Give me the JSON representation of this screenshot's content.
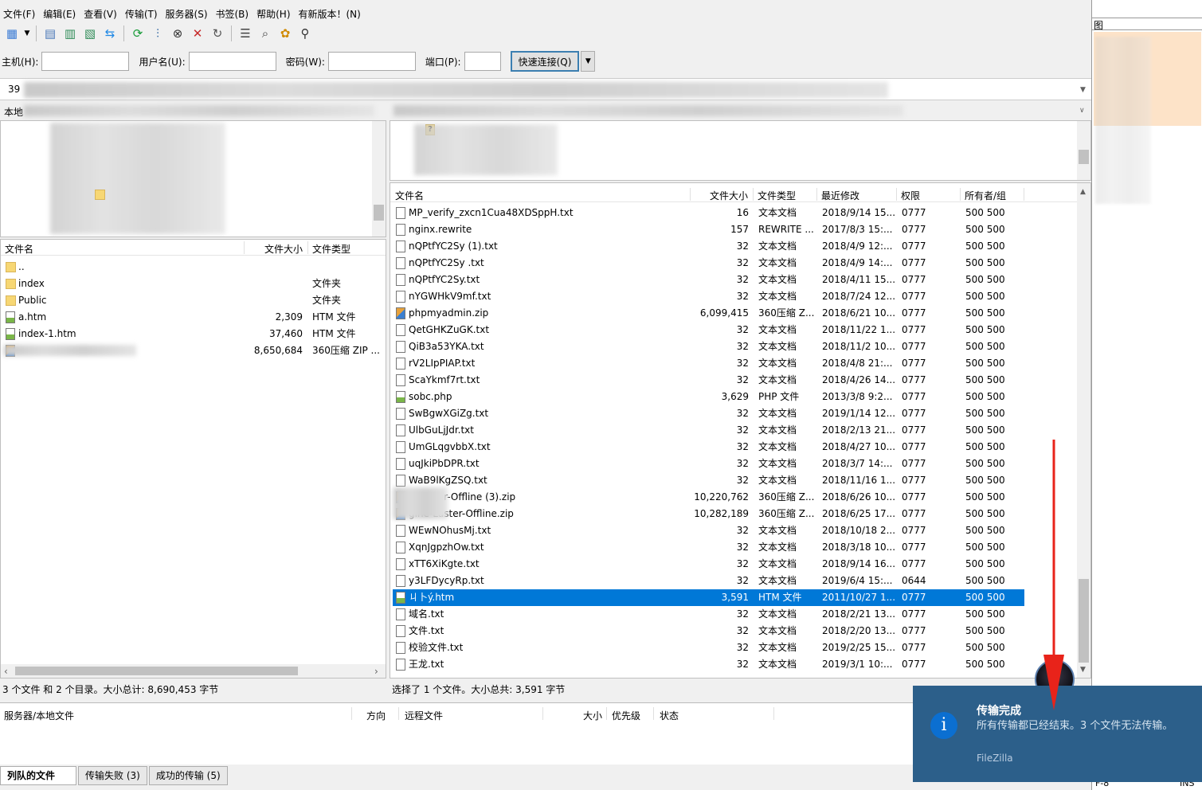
{
  "menu": [
    "文件(F)",
    "编辑(E)",
    "查看(V)",
    "传输(T)",
    "服务器(S)",
    "书签(B)",
    "帮助(H)",
    "有新版本！(N)"
  ],
  "quickconnect": {
    "host_label": "主机(H):",
    "user_label": "用户名(U):",
    "pass_label": "密码(W):",
    "port_label": "端口(P):",
    "button": "快速连接(Q)",
    "host_value": "",
    "user_value": "",
    "pass_value": "",
    "port_value": ""
  },
  "message_num": "39",
  "local": {
    "site_label": "本地",
    "headers": {
      "name": "文件名",
      "size": "文件大小",
      "type": "文件类型"
    },
    "files": [
      {
        "name": "..",
        "size": "",
        "type": "",
        "icon": "folder-icon"
      },
      {
        "name": "index",
        "size": "",
        "type": "文件夹",
        "icon": "folder-icon"
      },
      {
        "name": "Public",
        "size": "",
        "type": "文件夹",
        "icon": "folder-icon"
      },
      {
        "name": "a.htm",
        "size": "2,309",
        "type": "HTM 文件",
        "icon": "web-file-icon"
      },
      {
        "name": "index-1.htm",
        "size": "37,460",
        "type": "HTM 文件",
        "icon": "web-file-icon"
      },
      {
        "name": "",
        "size": "8,650,684",
        "type": "360压缩 ZIP ...",
        "icon": "zip-icon"
      }
    ],
    "status": "3 个文件 和 2 个目录。大小总计: 8,690,453 字节"
  },
  "remote": {
    "headers": {
      "name": "文件名",
      "size": "文件大小",
      "type": "文件类型",
      "modified": "最近修改",
      "perm": "权限",
      "owner": "所有者/组"
    },
    "files": [
      {
        "name": "MP_verify_zxcn1Cua48XDSppH.txt",
        "size": "16",
        "type": "文本文档",
        "modified": "2018/9/14 15...",
        "perm": "0777",
        "owner": "500 500"
      },
      {
        "name": "nginx.rewrite",
        "size": "157",
        "type": "REWRITE ...",
        "modified": "2017/8/3 15:...",
        "perm": "0777",
        "owner": "500 500"
      },
      {
        "name": "nQPtfYC2Sy (1).txt",
        "size": "32",
        "type": "文本文档",
        "modified": "2018/4/9 12:...",
        "perm": "0777",
        "owner": "500 500"
      },
      {
        "name": "nQPtfYC2Sy .txt",
        "size": "32",
        "type": "文本文档",
        "modified": "2018/4/9 14:...",
        "perm": "0777",
        "owner": "500 500"
      },
      {
        "name": "nQPtfYC2Sy.txt",
        "size": "32",
        "type": "文本文档",
        "modified": "2018/4/11 15...",
        "perm": "0777",
        "owner": "500 500"
      },
      {
        "name": "nYGWHkV9mf.txt",
        "size": "32",
        "type": "文本文档",
        "modified": "2018/7/24 12...",
        "perm": "0777",
        "owner": "500 500"
      },
      {
        "name": "phpmyadmin.zip",
        "size": "6,099,415",
        "type": "360压缩 Z...",
        "modified": "2018/6/21 10...",
        "perm": "0777",
        "owner": "500 500"
      },
      {
        "name": "QetGHKZuGK.txt",
        "size": "32",
        "type": "文本文档",
        "modified": "2018/11/22 1...",
        "perm": "0777",
        "owner": "500 500"
      },
      {
        "name": "QiB3a53YKA.txt",
        "size": "32",
        "type": "文本文档",
        "modified": "2018/11/2 10...",
        "perm": "0777",
        "owner": "500 500"
      },
      {
        "name": "rV2LIpPIAP.txt",
        "size": "32",
        "type": "文本文档",
        "modified": "2018/4/8 21:...",
        "perm": "0777",
        "owner": "500 500"
      },
      {
        "name": "ScaYkmf7rt.txt",
        "size": "32",
        "type": "文本文档",
        "modified": "2018/4/26 14...",
        "perm": "0777",
        "owner": "500 500"
      },
      {
        "name": "sobc.php",
        "size": "3,629",
        "type": "PHP 文件",
        "modified": "2013/3/8 9:2...",
        "perm": "0777",
        "owner": "500 500"
      },
      {
        "name": "SwBgwXGiZg.txt",
        "size": "32",
        "type": "文本文档",
        "modified": "2019/1/14 12...",
        "perm": "0777",
        "owner": "500 500"
      },
      {
        "name": "UlbGuLjJdr.txt",
        "size": "32",
        "type": "文本文档",
        "modified": "2018/2/13 21...",
        "perm": "0777",
        "owner": "500 500"
      },
      {
        "name": "UmGLqgvbbX.txt",
        "size": "32",
        "type": "文本文档",
        "modified": "2018/4/27 10...",
        "perm": "0777",
        "owner": "500 500"
      },
      {
        "name": "uqJkiPbDPR.txt",
        "size": "32",
        "type": "文本文档",
        "modified": "2018/3/7 14:...",
        "perm": "0777",
        "owner": "500 500"
      },
      {
        "name": "WaB9lKgZSQ.txt",
        "size": "32",
        "type": "文本文档",
        "modified": "2018/11/16 1...",
        "perm": "0777",
        "owner": "500 500"
      },
      {
        "name": "e-Laster-Offline (3).zip",
        "size": "10,220,762",
        "type": "360压缩 Z...",
        "modified": "2018/6/26 10...",
        "perm": "0777",
        "owner": "500 500"
      },
      {
        "name": "gine-Laster-Offline.zip",
        "size": "10,282,189",
        "type": "360压缩 Z...",
        "modified": "2018/6/25 17...",
        "perm": "0777",
        "owner": "500 500"
      },
      {
        "name": "WEwNOhusMj.txt",
        "size": "32",
        "type": "文本文档",
        "modified": "2018/10/18 2...",
        "perm": "0777",
        "owner": "500 500"
      },
      {
        "name": "XqnJgpzhOw.txt",
        "size": "32",
        "type": "文本文档",
        "modified": "2018/3/18 10...",
        "perm": "0777",
        "owner": "500 500"
      },
      {
        "name": "xTT6XiKgte.txt",
        "size": "32",
        "type": "文本文档",
        "modified": "2018/9/14 16...",
        "perm": "0777",
        "owner": "500 500"
      },
      {
        "name": "y3LFDycyRp.txt",
        "size": "32",
        "type": "文本文档",
        "modified": "2019/6/4 15:...",
        "perm": "0644",
        "owner": "500 500"
      },
      {
        "name": "ㄐ卜ý.htm",
        "size": "3,591",
        "type": "HTM 文件",
        "modified": "2011/10/27 1...",
        "perm": "0777",
        "owner": "500 500"
      },
      {
        "name": "域名.txt",
        "size": "32",
        "type": "文本文档",
        "modified": "2018/2/21 13...",
        "perm": "0777",
        "owner": "500 500"
      },
      {
        "name": "文件.txt",
        "size": "32",
        "type": "文本文档",
        "modified": "2018/2/20 13...",
        "perm": "0777",
        "owner": "500 500"
      },
      {
        "name": "校验文件.txt",
        "size": "32",
        "type": "文本文档",
        "modified": "2019/2/25 15...",
        "perm": "0777",
        "owner": "500 500"
      },
      {
        "name": "王龙.txt",
        "size": "32",
        "type": "文本文档",
        "modified": "2019/3/1 10:...",
        "perm": "0777",
        "owner": "500 500"
      }
    ],
    "selected_index": 23,
    "status": "选择了 1 个文件。大小总共: 3,591 字节"
  },
  "queue": {
    "headers": [
      "服务器/本地文件",
      "方向",
      "远程文件",
      "大小",
      "优先级",
      "状态"
    ],
    "tabs": [
      "列队的文件",
      "传输失败 (3)",
      "成功的传输 (5)"
    ]
  },
  "side": {
    "title": "图",
    "status1": "F-8",
    "status2": "INS"
  },
  "toast": {
    "title": "传输完成",
    "body": "所有传输都已经结束。3 个文件无法传输。",
    "app": "FileZilla",
    "icon": "info-icon"
  },
  "colors": {
    "selection": "#0078d7",
    "toast_bg": "#2c5f8a",
    "arrow": "#e8231a"
  }
}
